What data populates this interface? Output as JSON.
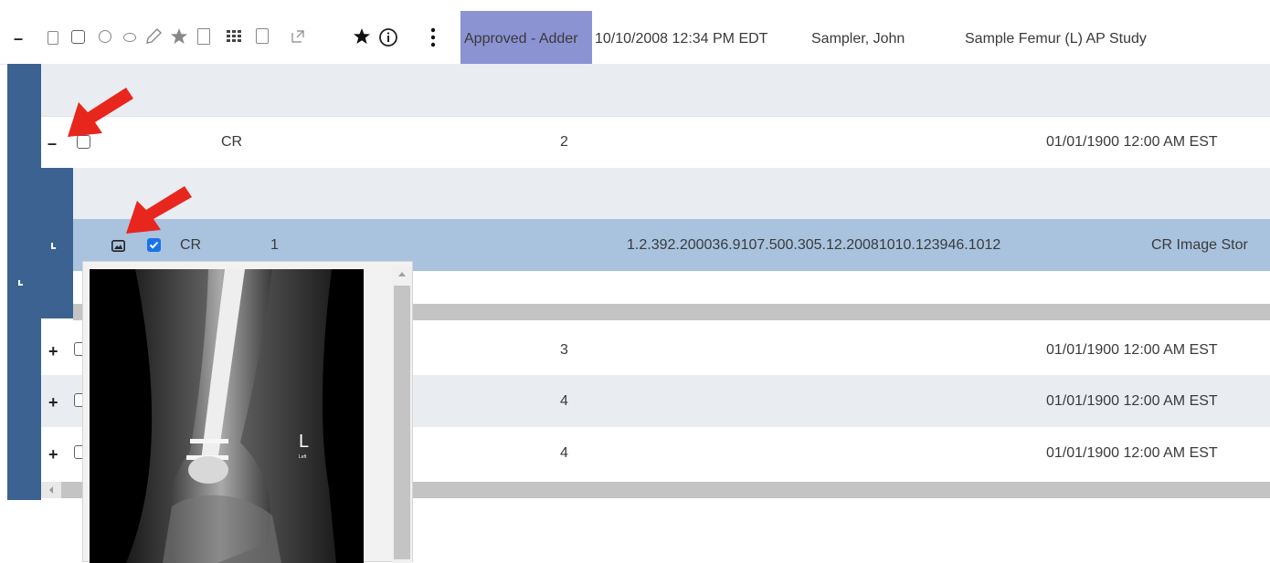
{
  "study": {
    "toggle": "–",
    "status": "Approved - Adder",
    "datetime": "10/10/2008 12:34 PM EDT",
    "patient": "Sampler, John",
    "description": "Sample Femur (L) AP Study",
    "status_color": "#8b93d3"
  },
  "series_open": {
    "toggle": "–",
    "modality": "CR",
    "count": "2",
    "date": "01/01/1900 12:00 AM EST"
  },
  "image_row": {
    "modality": "CR",
    "number": "1",
    "uid": "1.2.392.200036.9107.500.305.12.20081010.123946.1012",
    "sop": "CR Image Stor",
    "row_color": "#a9c3df"
  },
  "series_collapsed": [
    {
      "toggle": "+",
      "count": "3",
      "date": "01/01/1900 12:00 AM EST"
    },
    {
      "toggle": "+",
      "count": "4",
      "date": "01/01/1900 12:00 AM EST"
    },
    {
      "toggle": "+",
      "count": "4",
      "date": "01/01/1900 12:00 AM EST"
    }
  ],
  "xray": {
    "side_marker": "L",
    "side_marker_sub": "Left"
  },
  "colors": {
    "accent_dark": "#3b6290",
    "row_alt": "#e9edf1",
    "scrollbar": "#c4c4c4",
    "annotation_arrow": "#e8261e"
  }
}
